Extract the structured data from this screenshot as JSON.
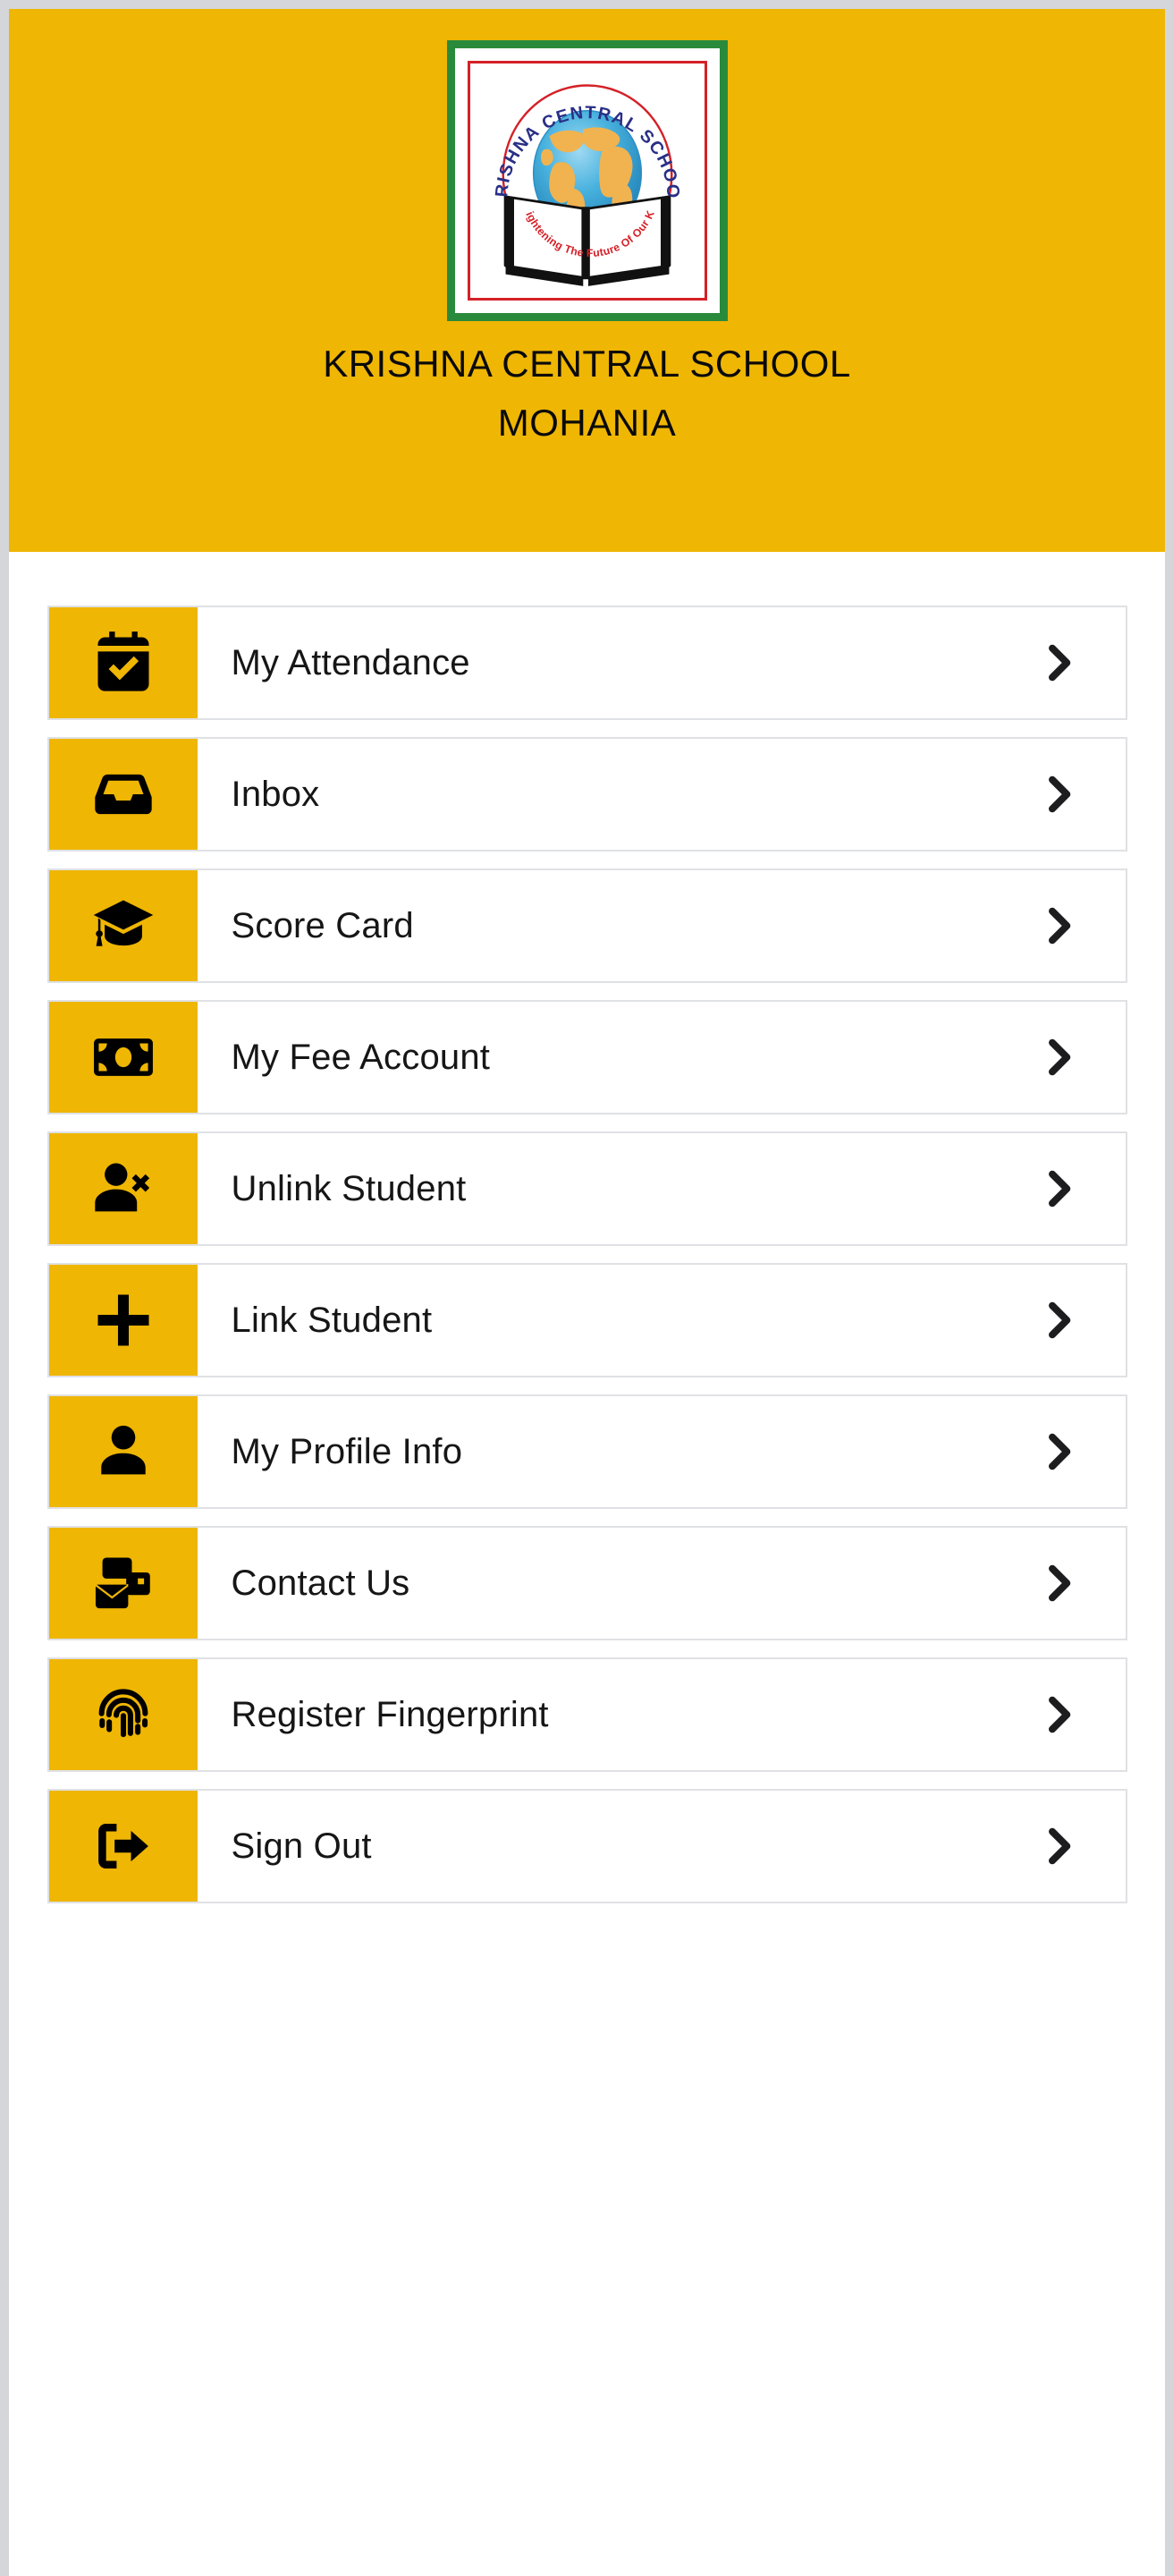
{
  "theme": {
    "brand_yellow": "#efb603",
    "card_border": "#dfe1e4",
    "text_dark": "#161616",
    "logo_border_green": "#2a8a3c",
    "logo_inner_red": "#d42128"
  },
  "header": {
    "school_name": "KRISHNA CENTRAL SCHOOL",
    "school_city": "MOHANIA",
    "logo": {
      "arc_text": "KRISHNA CENTRAL SCHOOL",
      "tagline": "Enlightening The Future Of Our Kids",
      "arc_text_color": "#2a2f86",
      "tagline_color": "#d42128"
    }
  },
  "menu": {
    "items": [
      {
        "label": "My Attendance",
        "icon": "calendar-check-icon"
      },
      {
        "label": "Inbox",
        "icon": "inbox-tray-icon"
      },
      {
        "label": "Score Card",
        "icon": "graduation-cap-icon"
      },
      {
        "label": "My Fee Account",
        "icon": "banknote-icon"
      },
      {
        "label": "Unlink Student",
        "icon": "person-remove-icon"
      },
      {
        "label": "Link Student",
        "icon": "plus-icon"
      },
      {
        "label": "My Profile Info",
        "icon": "person-icon"
      },
      {
        "label": "Contact Us",
        "icon": "contact-mail-icon"
      },
      {
        "label": "Register Fingerprint",
        "icon": "fingerprint-icon"
      },
      {
        "label": "Sign Out",
        "icon": "logout-icon"
      }
    ],
    "chevron_icon": "chevron-right-icon"
  }
}
